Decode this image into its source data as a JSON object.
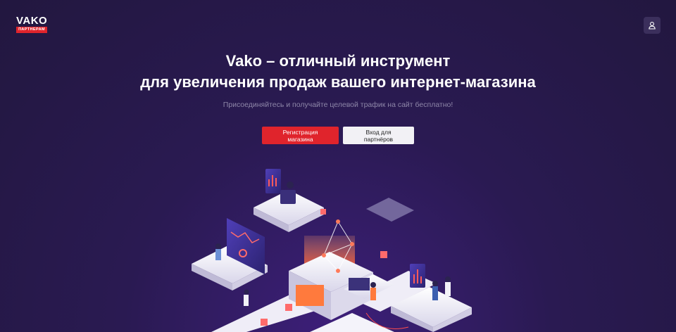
{
  "brand": {
    "name": "VAKO",
    "tagline": "ПАРТНЕРАМ"
  },
  "hero": {
    "title_line1": "Vako – отличный инструмент",
    "title_line2": "для увеличения продаж вашего интернет-магазина",
    "subtitle": "Присоединяйтесь и получайте целевой трафик на сайт бесплатно!"
  },
  "actions": {
    "register": "Регистрация магазина",
    "partner_login": "Вход для партнёров"
  },
  "icons": {
    "account": "user-icon"
  },
  "colors": {
    "accent": "#e0242c",
    "background": "#2a1a52"
  }
}
